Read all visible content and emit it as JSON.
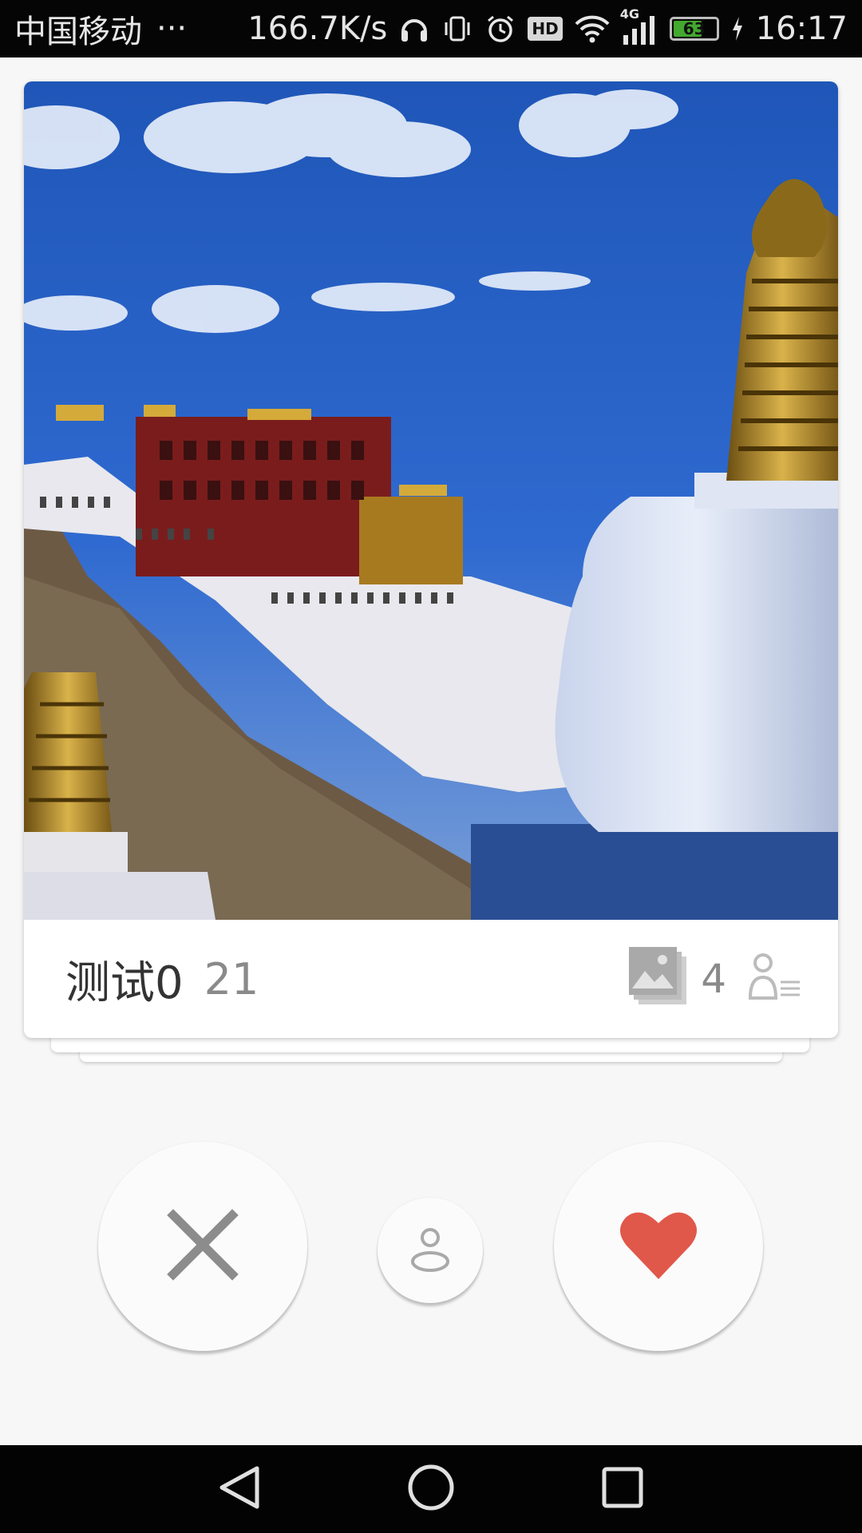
{
  "status_bar": {
    "carrier": "中国移动",
    "more": "···",
    "speed": "166.7K/s",
    "hd_label": "HD",
    "network_label": "4G",
    "battery_level": "63",
    "time": "16:17"
  },
  "card": {
    "name": "测试0",
    "age": "21",
    "photo_count": "4",
    "image_icon": "photo-stack-icon",
    "profile_icon": "profile-list-icon"
  },
  "actions": {
    "dislike_icon": "close-icon",
    "profile_icon": "person-icon",
    "like_icon": "heart-icon",
    "like_color": "#e0584a",
    "dislike_color": "#8c8c8c"
  },
  "nav": {
    "back_icon": "back-triangle-icon",
    "home_icon": "home-circle-icon",
    "recent_icon": "recent-square-icon"
  }
}
